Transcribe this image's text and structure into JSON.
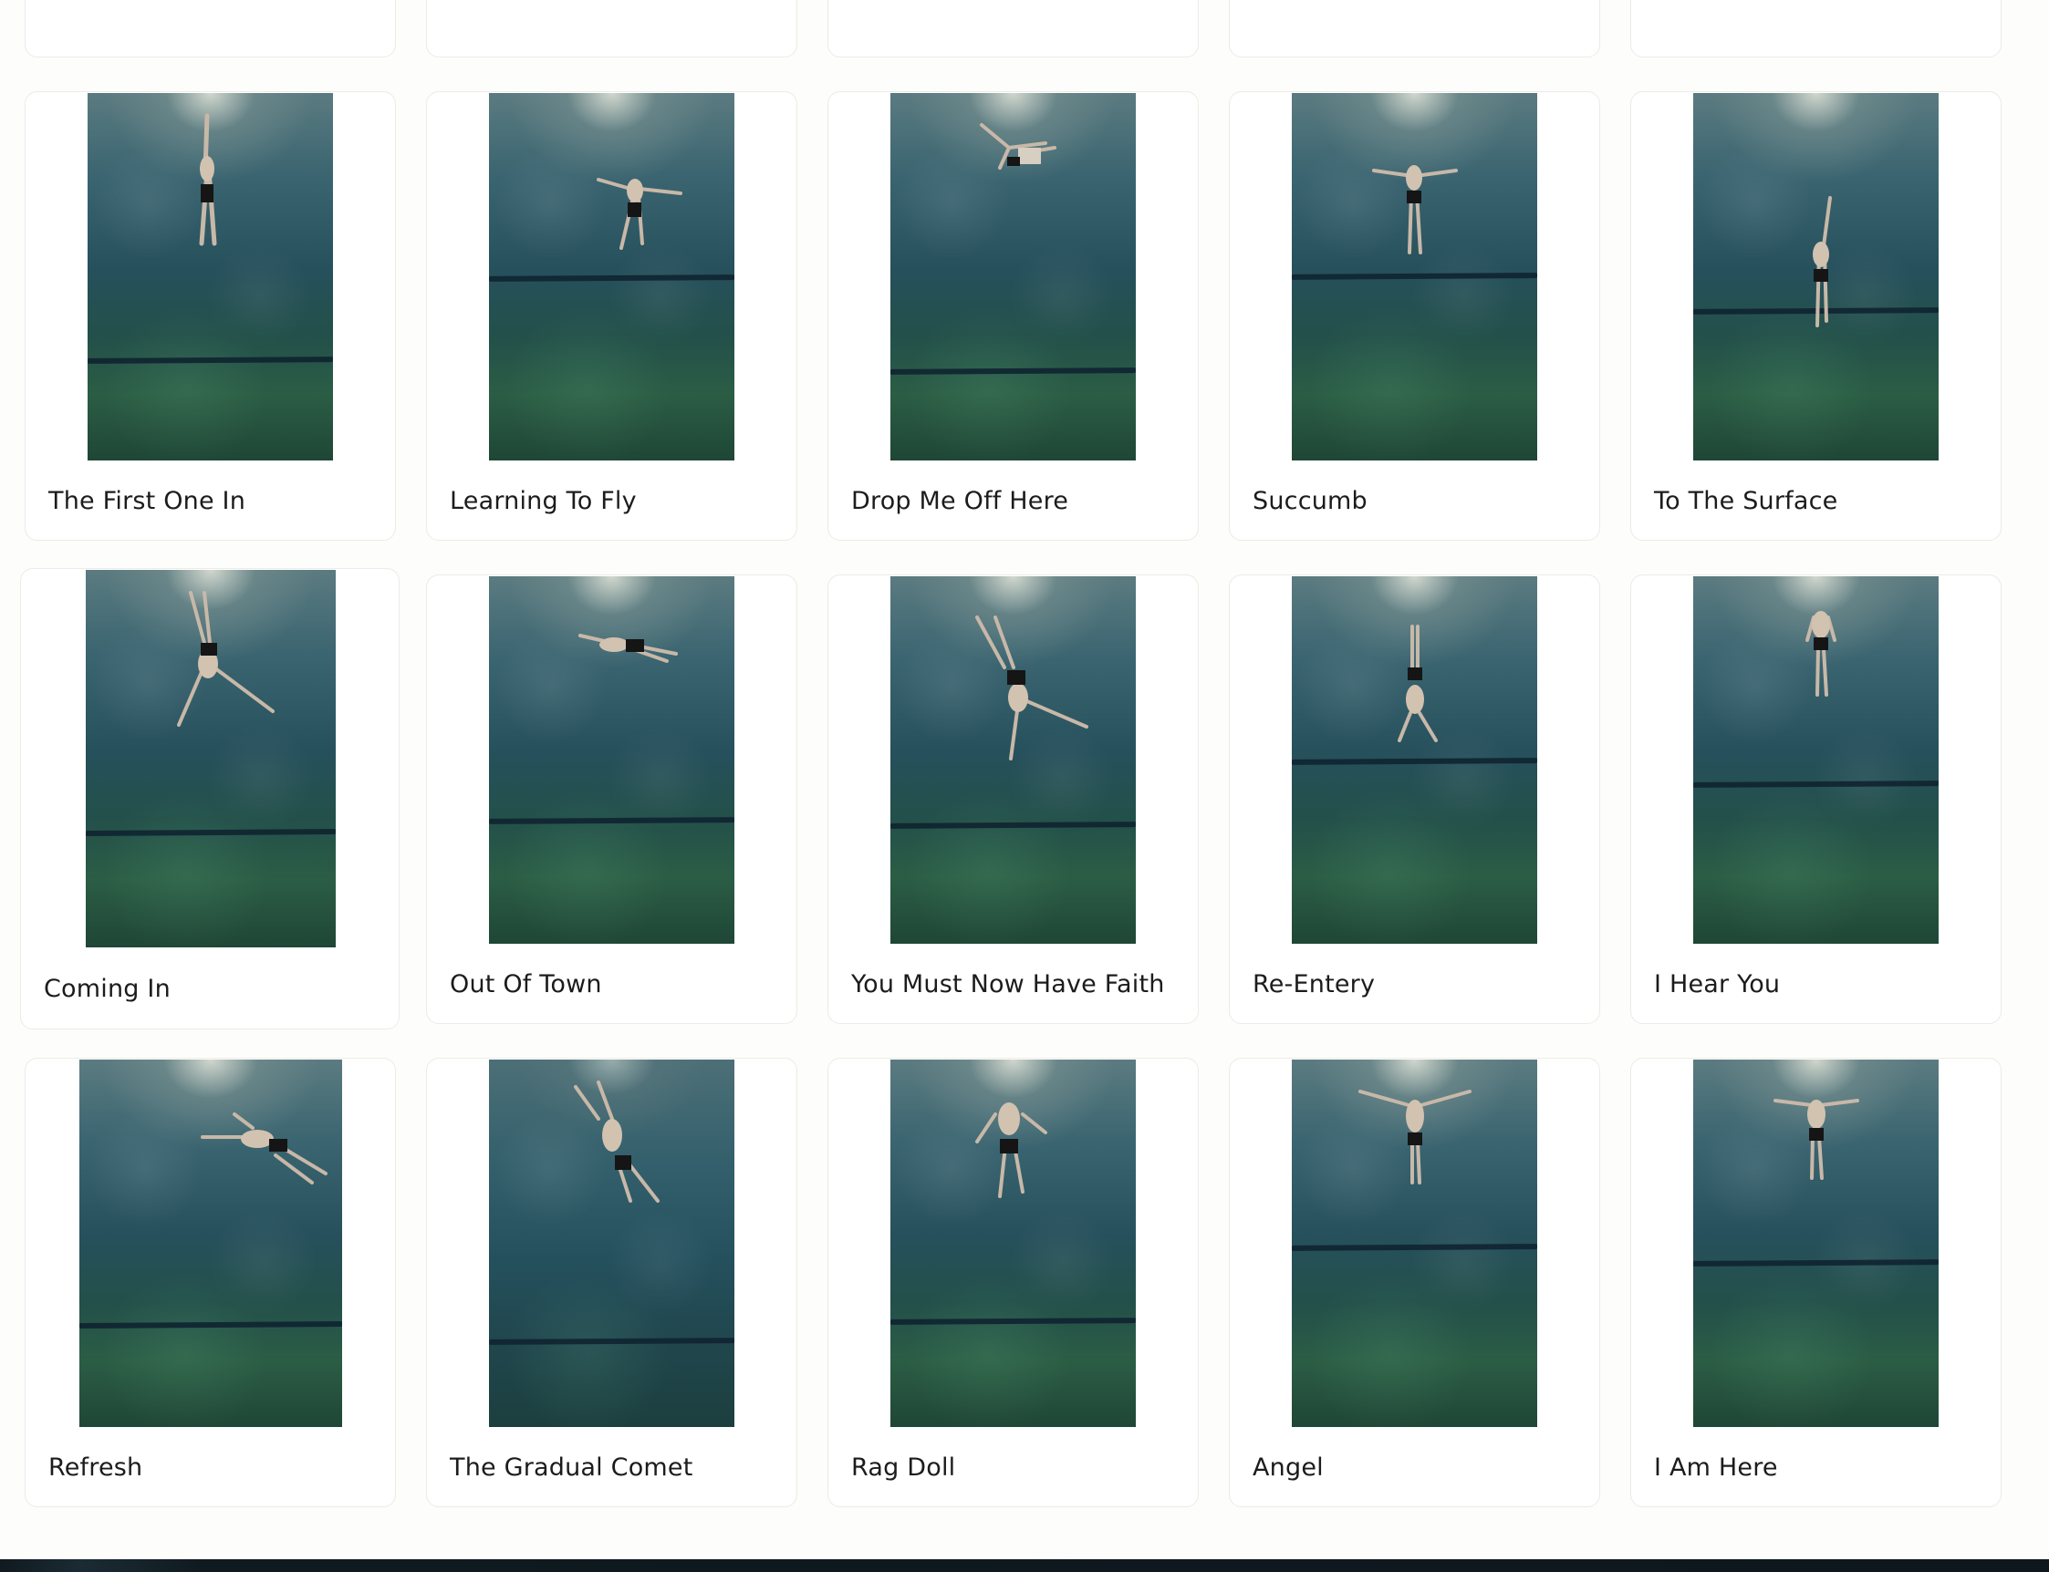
{
  "gallery": {
    "items": [
      {
        "title": "The First One In"
      },
      {
        "title": "Learning To Fly"
      },
      {
        "title": "Drop Me Off Here"
      },
      {
        "title": "Succumb"
      },
      {
        "title": "To The Surface"
      },
      {
        "title": "Coming In"
      },
      {
        "title": "Out Of Town"
      },
      {
        "title": "You Must Now Have Faith"
      },
      {
        "title": "Re-Entery"
      },
      {
        "title": "I Hear You"
      },
      {
        "title": "Refresh"
      },
      {
        "title": "The Gradual Comet"
      },
      {
        "title": "Rag Doll"
      },
      {
        "title": "Angel"
      },
      {
        "title": "I Am Here"
      }
    ]
  },
  "colors": {
    "page_background": "#fdfdfb",
    "card_border": "#ecebe6",
    "accent": "#6b2cf5",
    "text": "#1c1c1c"
  }
}
